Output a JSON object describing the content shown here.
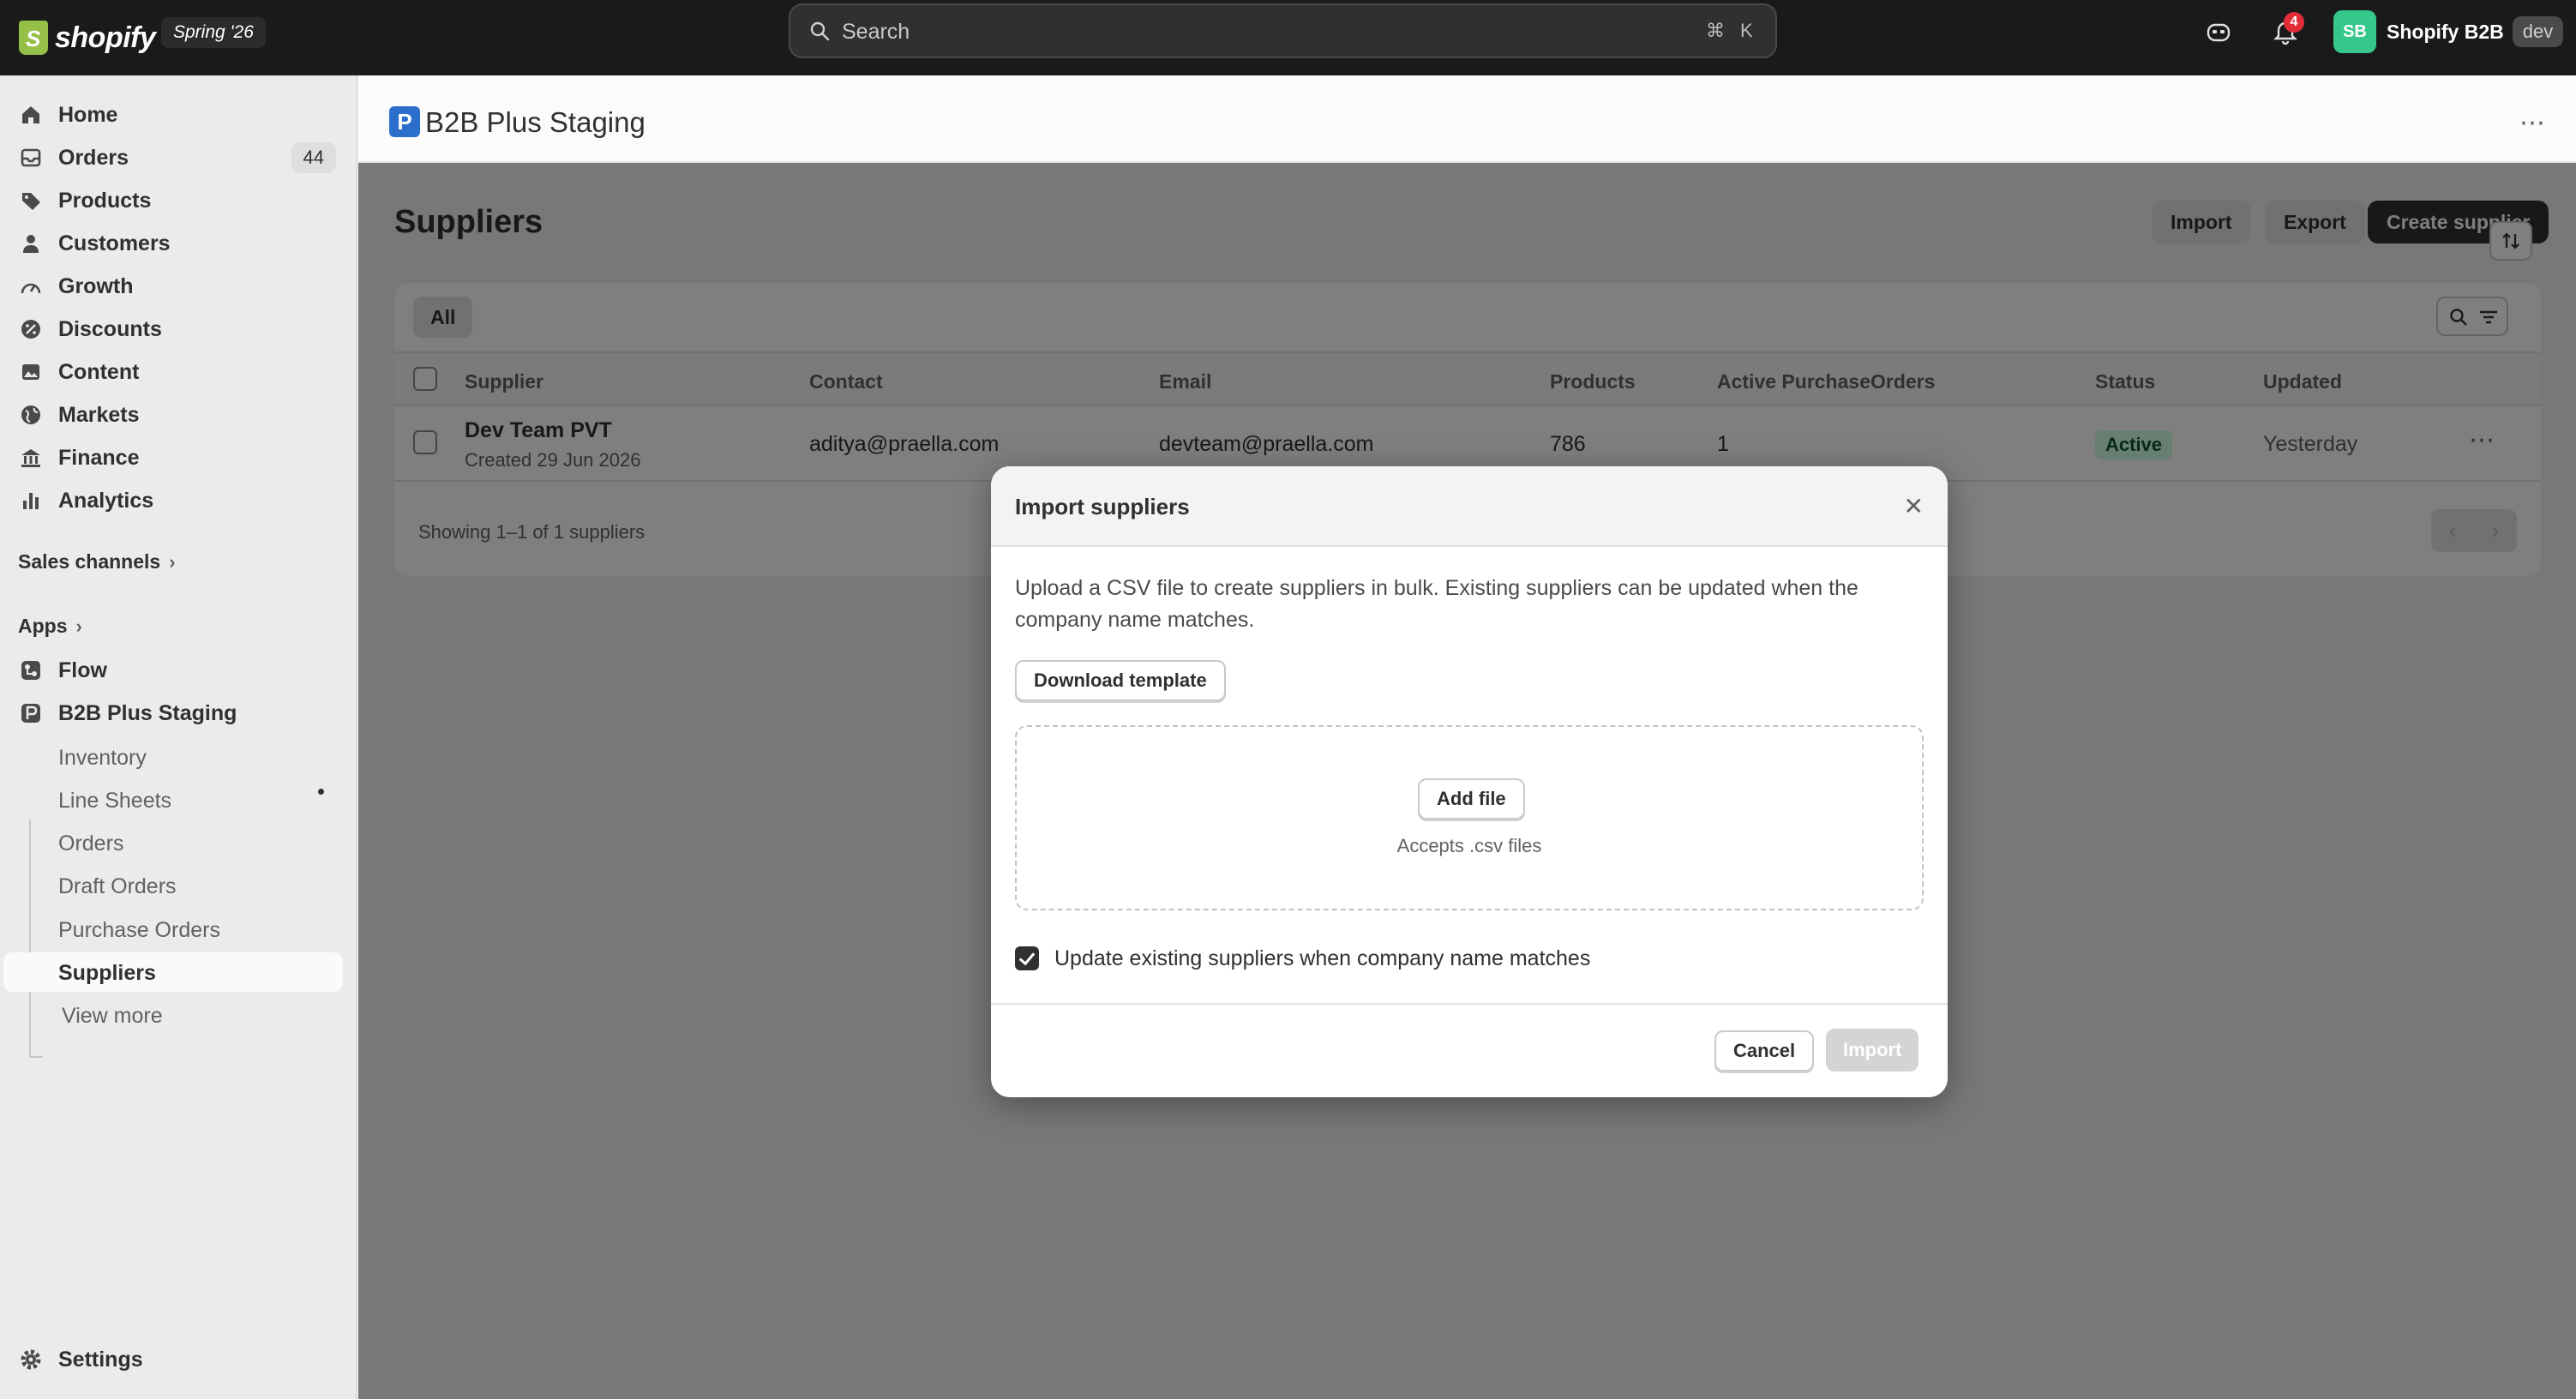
{
  "topbar": {
    "logo_text": "shopify",
    "edition": "Spring '26",
    "search_placeholder": "Search",
    "search_kbd_cmd": "⌘",
    "search_kbd_key": "K",
    "notifications_count": "4",
    "store_avatar": "SB",
    "store_name": "Shopify B2B",
    "store_env": "dev"
  },
  "sidebar": {
    "items": [
      {
        "label": "Home",
        "icon": "home-icon"
      },
      {
        "label": "Orders",
        "icon": "inbox-icon",
        "count": "44"
      },
      {
        "label": "Products",
        "icon": "tag-icon"
      },
      {
        "label": "Customers",
        "icon": "person-icon"
      },
      {
        "label": "Growth",
        "icon": "gauge-icon"
      },
      {
        "label": "Discounts",
        "icon": "discount-icon"
      },
      {
        "label": "Content",
        "icon": "content-icon"
      },
      {
        "label": "Markets",
        "icon": "globe-icon"
      },
      {
        "label": "Finance",
        "icon": "bank-icon"
      },
      {
        "label": "Analytics",
        "icon": "bar-chart-icon"
      }
    ],
    "sales_channels": "Sales channels",
    "apps": "Apps",
    "flow": "Flow",
    "app_name": "B2B Plus Staging",
    "sub_items": [
      "Inventory",
      "Line Sheets",
      "Orders",
      "Draft Orders",
      "Purchase Orders",
      "Suppliers"
    ],
    "view_more": "View more",
    "settings": "Settings"
  },
  "app_header": {
    "logo_letter": "P",
    "title": "B2B Plus Staging",
    "more": "⋯"
  },
  "page": {
    "title": "Suppliers",
    "import_label": "Import",
    "export_label": "Export",
    "create_label": "Create supplier"
  },
  "table": {
    "tab_all": "All",
    "headers": [
      "Supplier",
      "Contact",
      "Email",
      "Products",
      "Active PurchaseOrders",
      "Status",
      "Updated"
    ],
    "rows": [
      {
        "supplier": "Dev Team PVT",
        "created": "Created 29 Jun 2026",
        "contact": "aditya@praella.com",
        "email": "devteam@praella.com",
        "products": "786",
        "active_pos": "1",
        "status": "Active",
        "updated": "Yesterday"
      }
    ],
    "showing": "Showing 1–1 of 1 suppliers"
  },
  "modal": {
    "title": "Import suppliers",
    "description": "Upload a CSV file to create suppliers in bulk. Existing suppliers can be updated when the company name matches.",
    "download_template": "Download template",
    "add_file": "Add file",
    "accepts": "Accepts .csv files",
    "checkbox_label": "Update existing suppliers when company name matches",
    "checkbox_checked": true,
    "cancel": "Cancel",
    "import": "Import"
  },
  "colors": {
    "topbar": "#1a1a1a",
    "primary_button": "#303030",
    "status_active_bg": "#cdfee1",
    "avatar": "#36c88b",
    "app_logo": "#2c6ecb"
  }
}
